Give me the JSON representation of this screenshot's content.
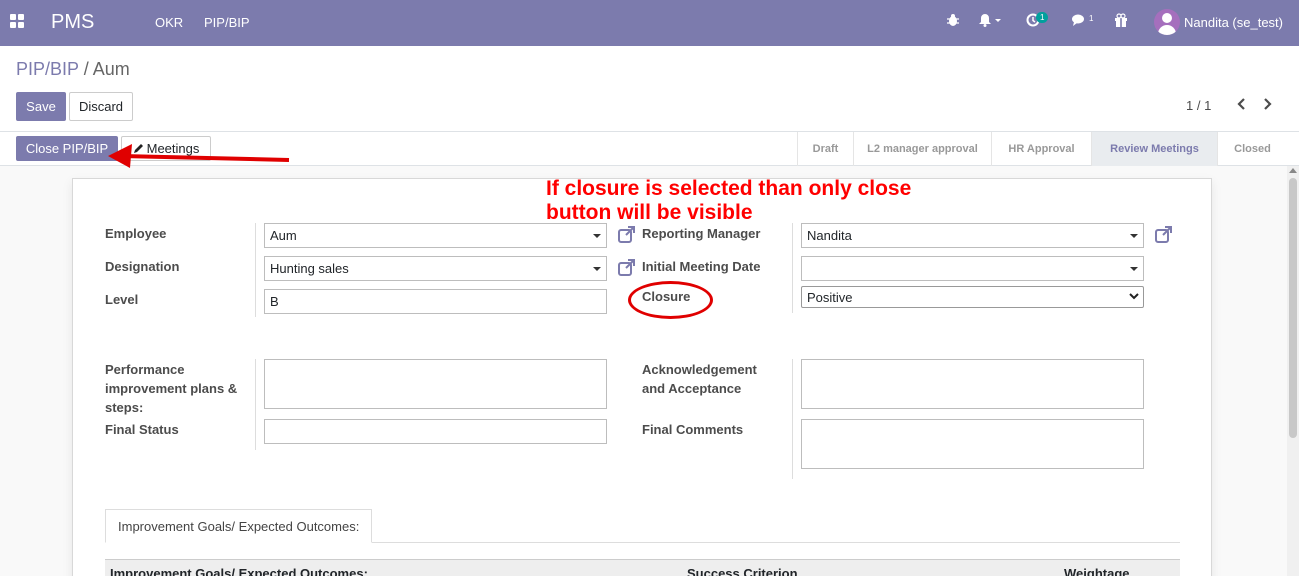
{
  "navbar": {
    "brand": "PMS",
    "menu": [
      "OKR",
      "PIP/BIP"
    ],
    "activity_count": "1",
    "message_count": "1",
    "user": "Nandita (se_test)"
  },
  "breadcrumb": {
    "parent": "PIP/BIP",
    "separator": "/",
    "current": "Aum"
  },
  "actions": {
    "save": "Save",
    "discard": "Discard"
  },
  "pager": "1 / 1",
  "statusbar": {
    "close_button": "Close PIP/BIP",
    "meetings_button": "Meetings",
    "stages": [
      "Draft",
      "L2 manager approval",
      "HR Approval",
      "Review Meetings",
      "Closed"
    ],
    "active_stage": "Review Meetings"
  },
  "annotation": {
    "line1": "If closure is selected than only close",
    "line2": "button will be visible"
  },
  "form": {
    "employee_label": "Employee",
    "employee_value": "Aum",
    "designation_label": "Designation",
    "designation_value": "Hunting sales",
    "level_label": "Level",
    "level_value": "B",
    "reporting_manager_label": "Reporting Manager",
    "reporting_manager_value": "Nandita",
    "initial_meeting_label": "Initial Meeting Date",
    "initial_meeting_value": "",
    "closure_label": "Closure",
    "closure_value": "Positive",
    "pip_steps_label": "Performance improvement plans & steps:",
    "final_status_label": "Final Status",
    "ack_label": "Acknowledgement and Acceptance",
    "final_comments_label": "Final Comments"
  },
  "tabs": {
    "goals_tab": "Improvement Goals/ Expected Outcomes:"
  },
  "table": {
    "columns": [
      "Improvement Goals/ Expected Outcomes:",
      "Success Criterion",
      "Weightage"
    ]
  },
  "colors": {
    "brand": "#7c7bad",
    "annotation": "#ff0000",
    "badge": "#00a09d"
  }
}
